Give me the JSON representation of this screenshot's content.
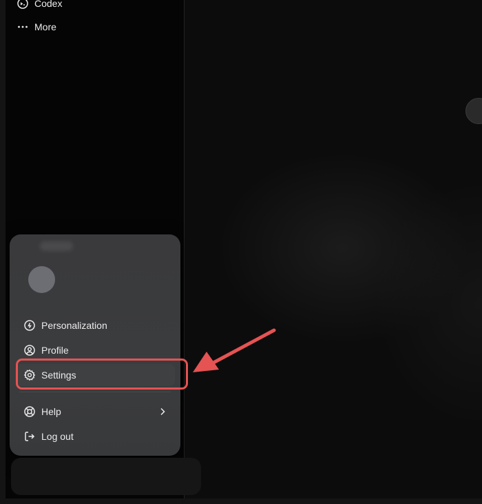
{
  "sidebar": {
    "items": [
      {
        "label": "Codex",
        "icon": "codex-icon"
      },
      {
        "label": "More",
        "icon": "more-dots-icon"
      }
    ]
  },
  "account_menu": {
    "items": [
      {
        "label": "Personalization",
        "icon": "personalization-icon"
      },
      {
        "label": "Profile",
        "icon": "profile-icon"
      },
      {
        "label": "Settings",
        "icon": "gear-icon"
      },
      {
        "label": "Help",
        "icon": "lifebuoy-icon",
        "has_submenu": true
      },
      {
        "label": "Log out",
        "icon": "logout-icon"
      }
    ]
  },
  "annotation": {
    "color": "#e55353",
    "target": "Settings"
  }
}
